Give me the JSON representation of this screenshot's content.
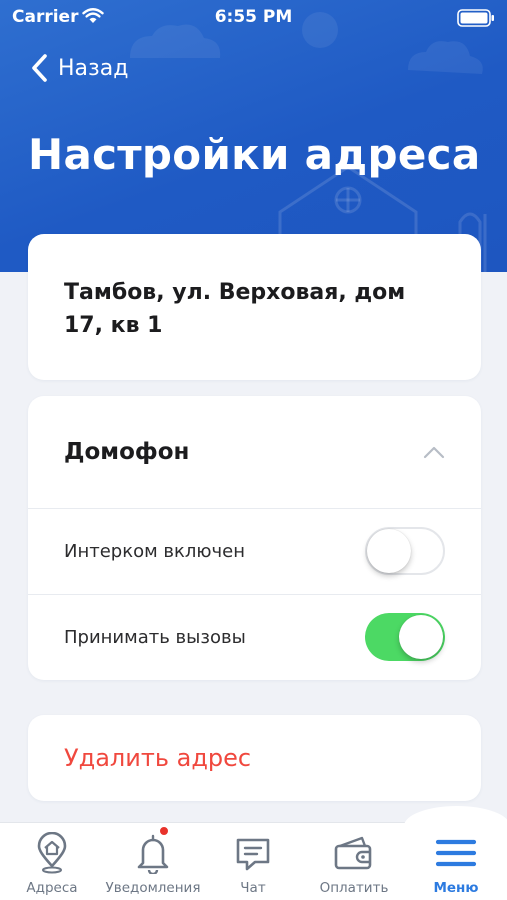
{
  "status_bar": {
    "carrier": "Carrier",
    "time": "6:55 PM"
  },
  "nav": {
    "back_label": "Назад"
  },
  "page": {
    "title": "Настройки адреса"
  },
  "address": {
    "text": "Тамбов, ул. Верховая, дом 17, кв 1"
  },
  "intercom": {
    "title": "Домофон",
    "expanded": true,
    "rows": [
      {
        "label": "Интерком включен",
        "enabled": false
      },
      {
        "label": "Принимать вызовы",
        "enabled": true
      }
    ]
  },
  "actions": {
    "delete_label": "Удалить адрес"
  },
  "tabs": [
    {
      "label": "Адреса",
      "icon": "location-pin-icon"
    },
    {
      "label": "Уведомления",
      "icon": "bell-icon",
      "has_badge": true
    },
    {
      "label": "Чат",
      "icon": "chat-bubble-icon"
    },
    {
      "label": "Оплатить",
      "icon": "wallet-icon"
    },
    {
      "label": "Меню",
      "icon": "hamburger-menu-icon",
      "active": true
    }
  ],
  "colors": {
    "header_blue": "#1f5ac4",
    "toggle_on": "#4cd964",
    "destructive_red": "#f0483e",
    "tab_active": "#2d7be0",
    "tab_inactive": "#6d7785",
    "badge_red": "#e8322b"
  }
}
